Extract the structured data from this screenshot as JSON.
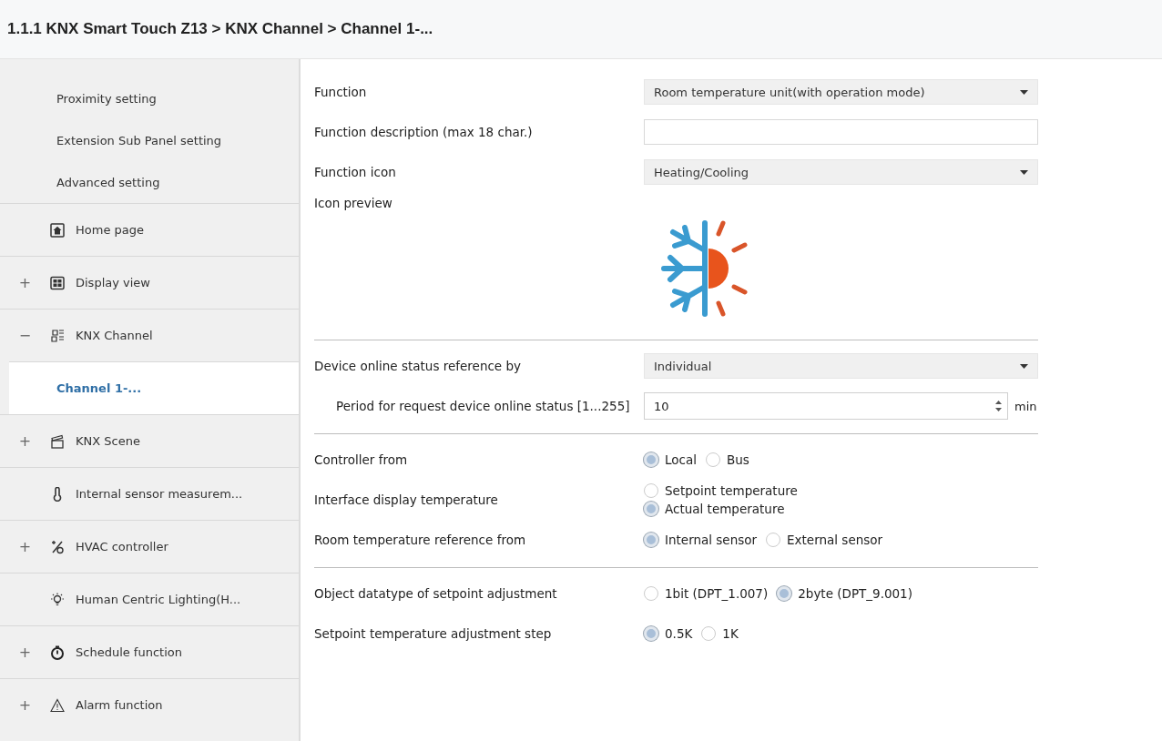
{
  "breadcrumb": "1.1.1 KNX Smart Touch Z13 > KNX Channel  > Channel 1-...",
  "sidebar": {
    "items": [
      {
        "label": "Proximity setting",
        "kind": "sub",
        "selected": false
      },
      {
        "label": "Extension Sub Panel setting",
        "kind": "sub",
        "selected": false
      },
      {
        "label": "Advanced setting",
        "kind": "sub",
        "selected": false
      },
      {
        "label": "Home page",
        "kind": "main",
        "selected": false
      },
      {
        "label": "Display view",
        "kind": "main",
        "toggle": "+",
        "selected": false
      },
      {
        "label": "KNX Channel",
        "kind": "main",
        "toggle": "−",
        "selected": false
      },
      {
        "label": "Channel 1-...",
        "kind": "child",
        "selected": true
      },
      {
        "label": "KNX Scene",
        "kind": "main",
        "toggle": "+",
        "selected": false
      },
      {
        "label": "Internal sensor measurem...",
        "kind": "main",
        "selected": false
      },
      {
        "label": "HVAC controller",
        "kind": "main",
        "toggle": "+",
        "selected": false
      },
      {
        "label": "Human Centric Lighting(H...",
        "kind": "main",
        "selected": false
      },
      {
        "label": "Schedule function",
        "kind": "main",
        "toggle": "+",
        "selected": false
      },
      {
        "label": "Alarm function",
        "kind": "main",
        "toggle": "+",
        "selected": false
      }
    ]
  },
  "sections": [
    {
      "rows": [
        {
          "kind": "dropdown",
          "label": "Function",
          "value": "Room temperature unit(with operation mode)"
        },
        {
          "kind": "text",
          "label": "Function description (max 18 char.)"
        },
        {
          "kind": "dropdown",
          "label": "Function icon",
          "value": "Heating/Cooling"
        },
        {
          "kind": "preview",
          "label": "Icon preview"
        }
      ]
    },
    {
      "rows": [
        {
          "kind": "dropdown",
          "label": "Device online status reference by",
          "value": "Individual"
        },
        {
          "kind": "spinner",
          "label": "Period for request device online status [1...255]",
          "value": "10",
          "unit": "min"
        }
      ]
    },
    {
      "rows": [
        {
          "kind": "radio",
          "label": "Controller from",
          "options": [
            {
              "label": "Local",
              "selected": true
            },
            {
              "label": "Bus",
              "selected": false
            }
          ]
        },
        {
          "kind": "radio-stack",
          "label": "Interface display temperature",
          "options": [
            {
              "label": "Setpoint temperature",
              "selected": false
            },
            {
              "label": "Actual temperature",
              "selected": true
            }
          ]
        },
        {
          "kind": "radio",
          "label": "Room temperature reference from",
          "options": [
            {
              "label": "Internal sensor",
              "selected": true
            },
            {
              "label": "External sensor",
              "selected": false
            }
          ]
        }
      ]
    },
    {
      "rows": [
        {
          "kind": "radio",
          "label": "Object datatype of setpoint adjustment",
          "options": [
            {
              "label": "1bit (DPT_1.007)",
              "selected": false
            },
            {
              "label": "2byte (DPT_9.001)",
              "selected": true
            }
          ]
        },
        {
          "kind": "radio",
          "label": "Setpoint temperature adjustment step",
          "options": [
            {
              "label": "0.5K",
              "selected": true
            },
            {
              "label": "1K",
              "selected": false
            }
          ]
        }
      ]
    }
  ]
}
